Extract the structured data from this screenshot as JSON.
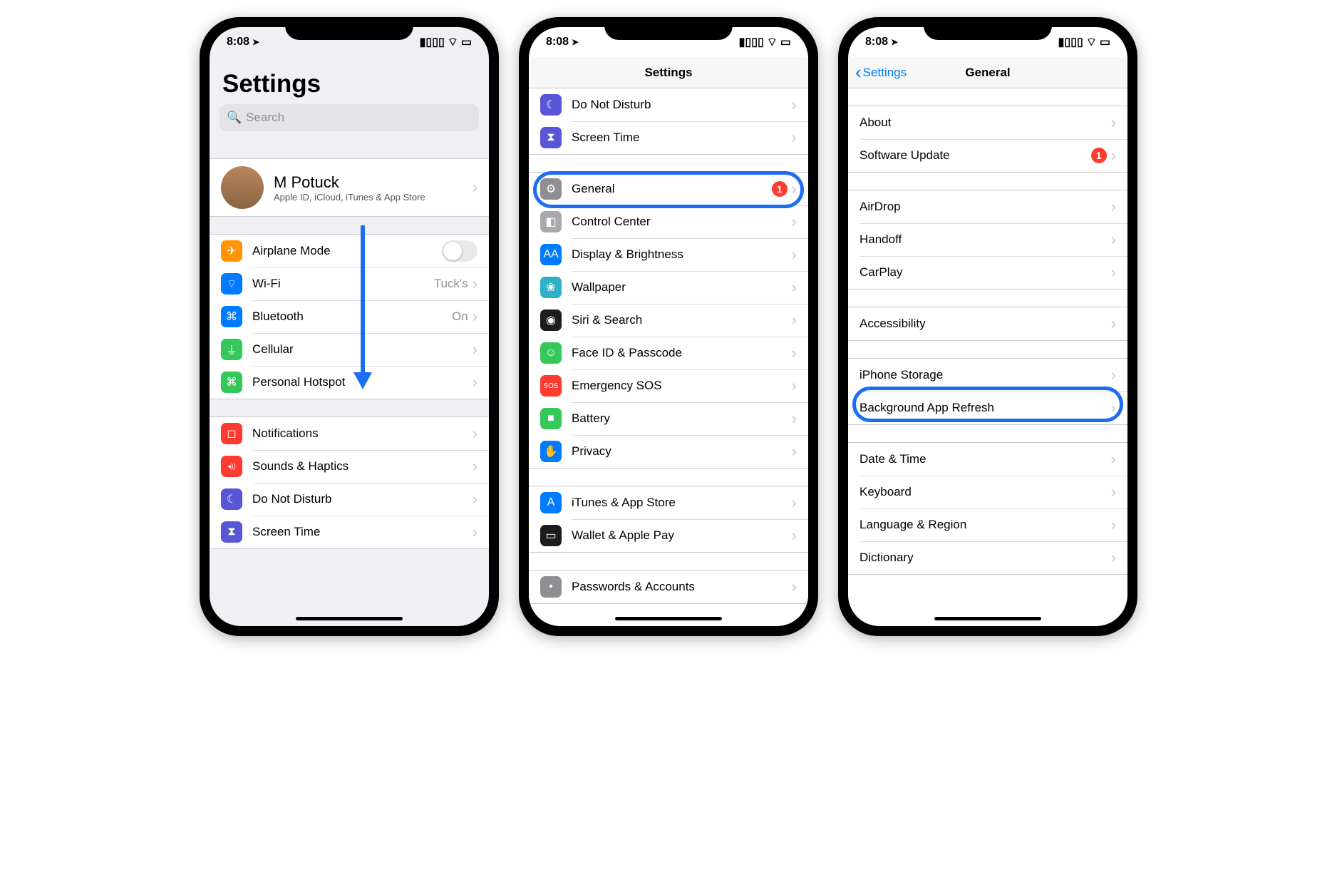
{
  "status": {
    "time": "8:08",
    "location_glyph": "➤"
  },
  "screen1": {
    "title": "Settings",
    "search_placeholder": "Search",
    "profile": {
      "name": "M Potuck",
      "subtitle": "Apple ID, iCloud, iTunes & App Store"
    },
    "groupA": [
      {
        "icon": "airplane-icon",
        "color": "orange",
        "glyph": "✈",
        "label": "Airplane Mode",
        "toggle": true
      },
      {
        "icon": "wifi-icon",
        "color": "blue",
        "glyph": "⌔",
        "label": "Wi-Fi",
        "detail": "Tuck's"
      },
      {
        "icon": "bluetooth-icon",
        "color": "blue",
        "glyph": "⌘",
        "label": "Bluetooth",
        "detail": "On"
      },
      {
        "icon": "cellular-icon",
        "color": "green",
        "glyph": "⏚",
        "label": "Cellular"
      },
      {
        "icon": "hotspot-icon",
        "color": "green",
        "glyph": "⌘",
        "label": "Personal Hotspot"
      }
    ],
    "groupB": [
      {
        "icon": "notifications-icon",
        "color": "red",
        "glyph": "◻",
        "label": "Notifications"
      },
      {
        "icon": "sounds-icon",
        "color": "red",
        "glyph": "◂))",
        "label": "Sounds & Haptics"
      },
      {
        "icon": "dnd-icon",
        "color": "indigo",
        "glyph": "☾",
        "label": "Do Not Disturb"
      },
      {
        "icon": "screentime-icon",
        "color": "indigo",
        "glyph": "⧗",
        "label": "Screen Time"
      }
    ]
  },
  "screen2": {
    "nav_title": "Settings",
    "groupA": [
      {
        "icon": "dnd-icon",
        "color": "indigo",
        "glyph": "☾",
        "label": "Do Not Disturb"
      },
      {
        "icon": "screentime-icon",
        "color": "indigo",
        "glyph": "⧗",
        "label": "Screen Time"
      }
    ],
    "groupB": [
      {
        "icon": "general-icon",
        "color": "gray",
        "glyph": "⚙",
        "label": "General",
        "badge": "1"
      },
      {
        "icon": "control-icon",
        "color": "lgray",
        "glyph": "◧",
        "label": "Control Center"
      },
      {
        "icon": "display-icon",
        "color": "blue",
        "glyph": "AA",
        "label": "Display & Brightness"
      },
      {
        "icon": "wallpaper-icon",
        "color": "teal",
        "glyph": "❀",
        "label": "Wallpaper"
      },
      {
        "icon": "siri-icon",
        "color": "black",
        "glyph": "◉",
        "label": "Siri & Search"
      },
      {
        "icon": "faceid-icon",
        "color": "green",
        "glyph": "☺",
        "label": "Face ID & Passcode"
      },
      {
        "icon": "sos-icon",
        "color": "red",
        "glyph": "SOS",
        "label": "Emergency SOS"
      },
      {
        "icon": "battery-icon",
        "color": "green",
        "glyph": "■",
        "label": "Battery"
      },
      {
        "icon": "privacy-icon",
        "color": "blue",
        "glyph": "✋",
        "label": "Privacy"
      }
    ],
    "groupC": [
      {
        "icon": "appstore-icon",
        "color": "blue",
        "glyph": "A",
        "label": "iTunes & App Store"
      },
      {
        "icon": "wallet-icon",
        "color": "black",
        "glyph": "▭",
        "label": "Wallet & Apple Pay"
      }
    ],
    "groupD": [
      {
        "icon": "passwords-icon",
        "color": "gray",
        "glyph": "•",
        "label": "Passwords & Accounts"
      }
    ]
  },
  "screen3": {
    "back_label": "Settings",
    "nav_title": "General",
    "groupA": [
      {
        "label": "About"
      },
      {
        "label": "Software Update",
        "badge": "1"
      }
    ],
    "groupB": [
      {
        "label": "AirDrop"
      },
      {
        "label": "Handoff"
      },
      {
        "label": "CarPlay"
      }
    ],
    "groupC": [
      {
        "label": "Accessibility"
      }
    ],
    "groupD": [
      {
        "label": "iPhone Storage"
      },
      {
        "label": "Background App Refresh"
      }
    ],
    "groupE": [
      {
        "label": "Date & Time"
      },
      {
        "label": "Keyboard"
      },
      {
        "label": "Language & Region"
      },
      {
        "label": "Dictionary"
      }
    ]
  }
}
